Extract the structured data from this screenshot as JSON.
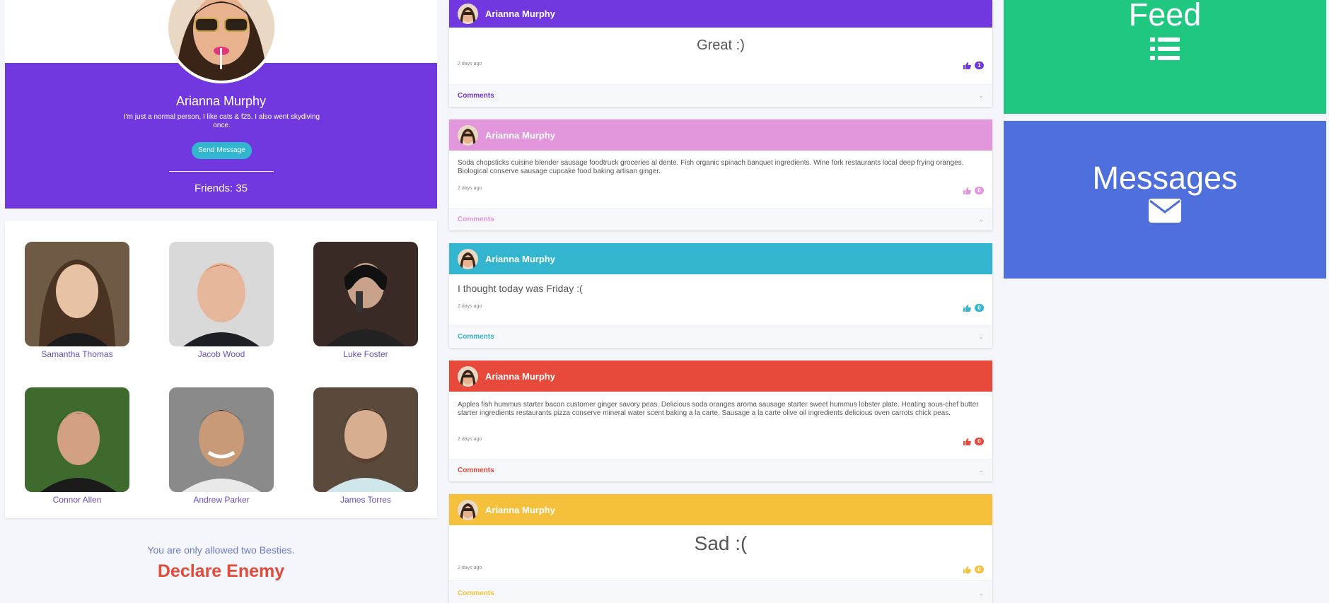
{
  "profile": {
    "name": "Arianna Murphy",
    "bio": "I'm just a normal person, I like cats & f25. I also went skydiving once.",
    "send_message": "Send Message",
    "friends_label": "Friends: 35",
    "accent": "#7238e0",
    "button_color": "#30b6cf"
  },
  "friends": [
    {
      "name": "Samantha Thomas"
    },
    {
      "name": "Jacob Wood"
    },
    {
      "name": "Luke Foster"
    },
    {
      "name": "Connor Allen"
    },
    {
      "name": "Andrew Parker"
    },
    {
      "name": "James Torres"
    }
  ],
  "besties": {
    "note": "You are only allowed two Besties.",
    "declare": "Declare Enemy"
  },
  "posts": [
    {
      "author": "Arianna Murphy",
      "text": "Great :)",
      "time": "2 days ago",
      "likes": "1",
      "comments": "Comments",
      "color": "#7238e0"
    },
    {
      "author": "Arianna Murphy",
      "text": "Soda chopsticks cuisine blender sausage foodtruck groceries al dente. Fish organic spinach banquet ingredients. Wine fork restaurants local deep frying oranges. Biological conserve sausage cupcake food baking artisan ginger.",
      "time": "2 days ago",
      "likes": "0",
      "comments": "Comments",
      "color": "#e296dc"
    },
    {
      "author": "Arianna Murphy",
      "text": "I thought today was Friday :(",
      "time": "2 days ago",
      "likes": "0",
      "comments": "Comments",
      "color": "#33b5cf"
    },
    {
      "author": "Arianna Murphy",
      "text": "Apples fish hummus starter bacon customer ginger savory peas. Delicious soda oranges aroma sausage starter sweet hummus lobster plate. Heating sous-chef butter starter ingredients restaurants pizza conserve mineral water scent baking a la carte. Sausage a la carte olive oil ingredients delicious oven carrots chick peas.",
      "time": "2 days ago",
      "likes": "0",
      "comments": "Comments",
      "color": "#e74a3a"
    },
    {
      "author": "Arianna Murphy",
      "text": "Sad :(",
      "time": "2 days ago",
      "likes": "0",
      "comments": "Comments",
      "color": "#f5c13d"
    }
  ],
  "tiles": {
    "feed": {
      "title": "Feed",
      "icon": "list-icon",
      "color": "#1fc781"
    },
    "messages": {
      "title": "Messages",
      "icon": "envelope-icon",
      "color": "#4f6fdc"
    }
  }
}
